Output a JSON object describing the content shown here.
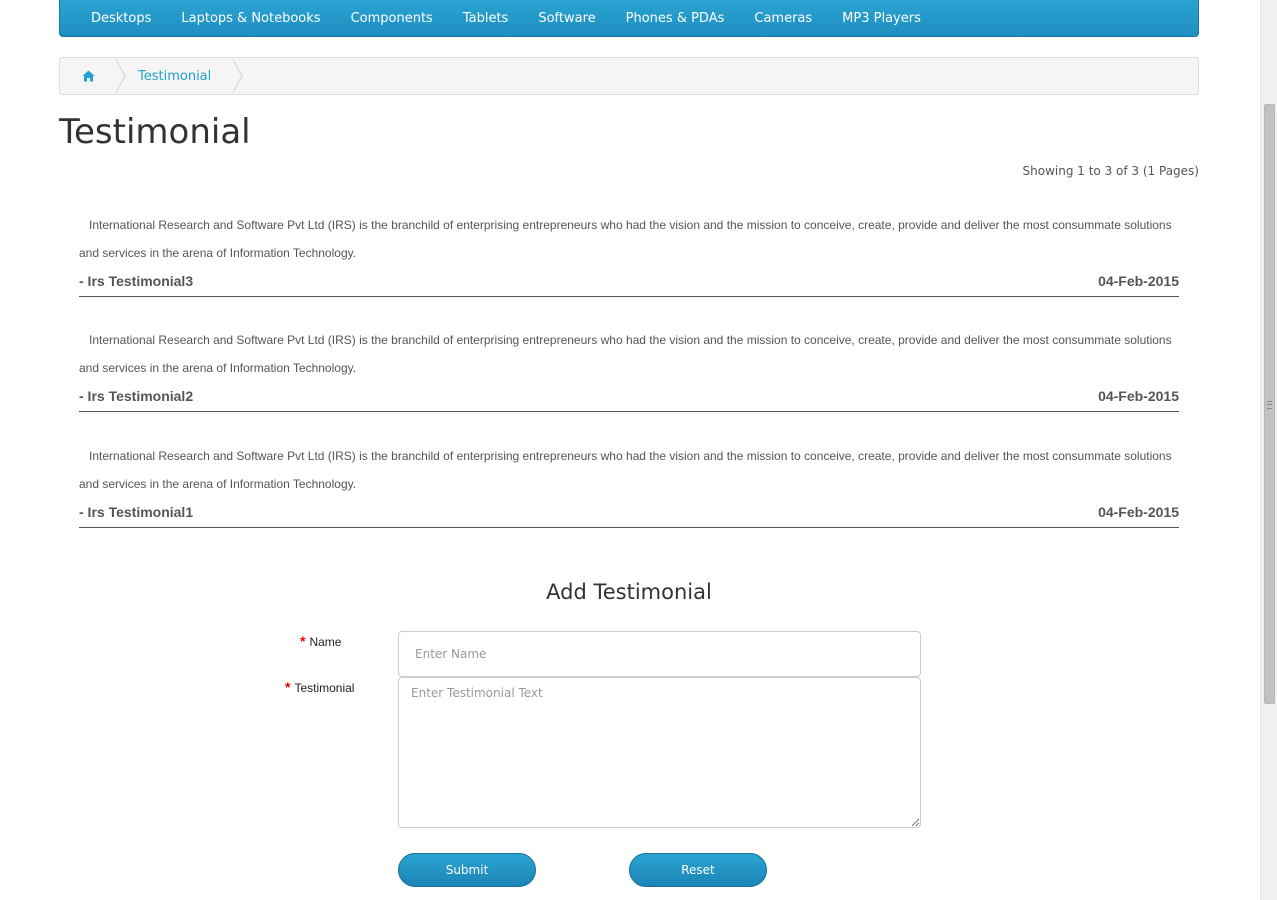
{
  "nav": {
    "items": [
      {
        "label": "Desktops"
      },
      {
        "label": "Laptops & Notebooks"
      },
      {
        "label": "Components"
      },
      {
        "label": "Tablets"
      },
      {
        "label": "Software"
      },
      {
        "label": "Phones & PDAs"
      },
      {
        "label": "Cameras"
      },
      {
        "label": "MP3 Players"
      }
    ]
  },
  "breadcrumb": {
    "home_icon": "home-icon",
    "current": "Testimonial"
  },
  "page": {
    "title": "Testimonial",
    "pagination_info": "Showing 1 to 3 of 3 (1 Pages)"
  },
  "testimonials": [
    {
      "text": "International Research and Software Pvt Ltd (IRS) is the branchild of enterprising entrepreneurs who had the vision and the mission to conceive, create, provide and deliver the most consummate solutions and services in the arena of Information Technology.",
      "author": "- Irs Testimonial3",
      "date": "04-Feb-2015"
    },
    {
      "text": "International Research and Software Pvt Ltd (IRS) is the branchild of enterprising entrepreneurs who had the vision and the mission to conceive, create, provide and deliver the most consummate solutions and services in the arena of Information Technology.",
      "author": "- Irs Testimonial2",
      "date": "04-Feb-2015"
    },
    {
      "text": "International Research and Software Pvt Ltd (IRS) is the branchild of enterprising entrepreneurs who had the vision and the mission to conceive, create, provide and deliver the most consummate solutions and services in the arena of Information Technology.",
      "author": "- Irs Testimonial1",
      "date": "04-Feb-2015"
    }
  ],
  "form": {
    "title": "Add Testimonial",
    "required_mark": "*",
    "name_label": "Name",
    "name_placeholder": "Enter Name",
    "name_value": "",
    "testimonial_label": "Testimonial",
    "testimonial_placeholder": "Enter Testimonial Text",
    "testimonial_value": "",
    "submit_label": "Submit",
    "reset_label": "Reset"
  },
  "colors": {
    "nav_bg": "#1e8ec0",
    "link": "#23a1d1",
    "required": "#ee0000"
  }
}
